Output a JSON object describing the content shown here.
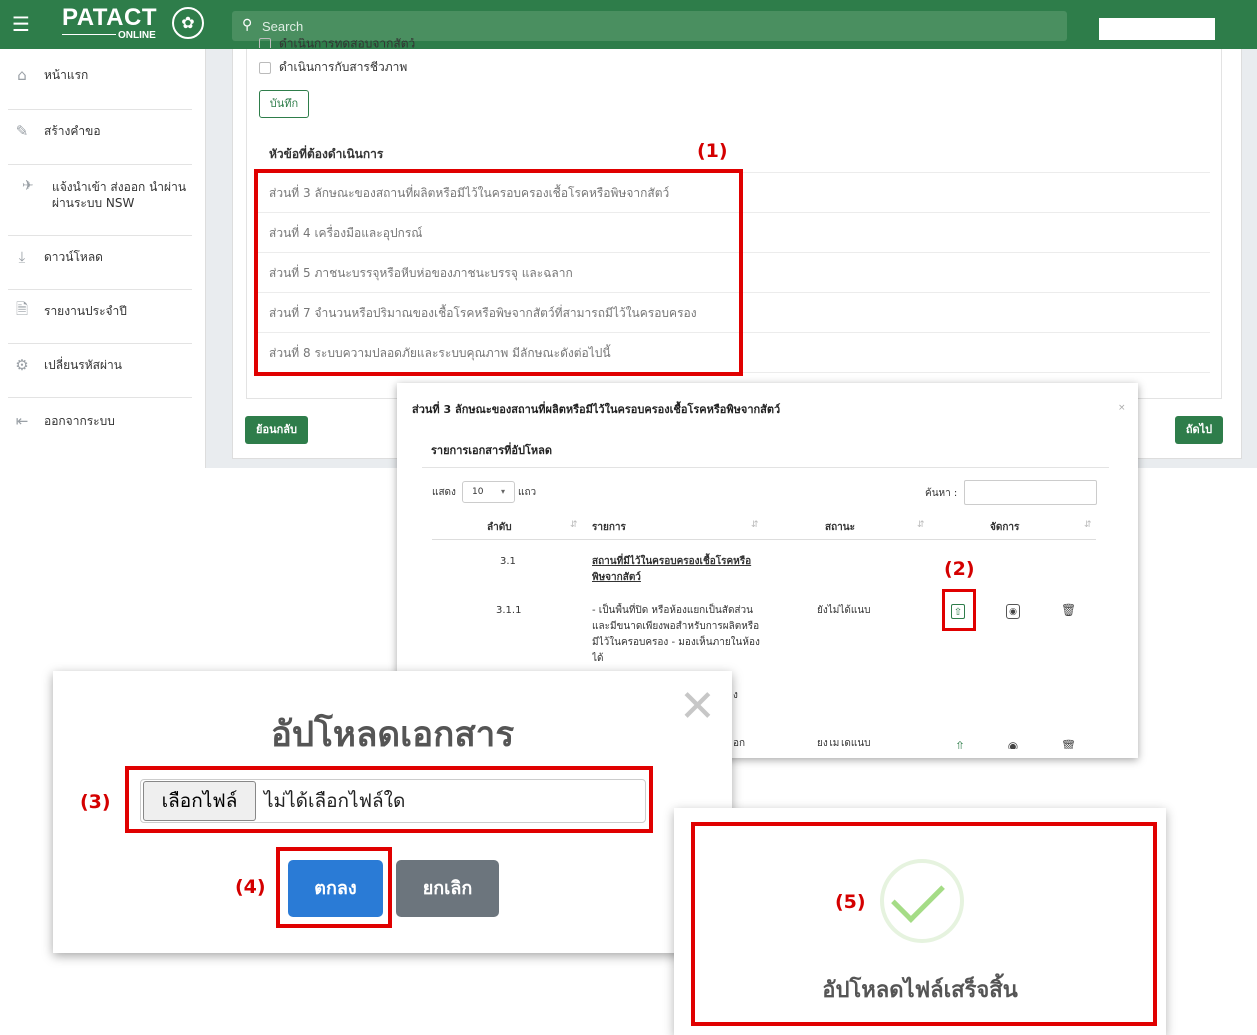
{
  "topbar": {
    "menu_icon": "hamburger-icon",
    "logo_text": "PATACT",
    "logo_sub": "ONLINE",
    "search_placeholder": "Search",
    "brand_color": "#2e7d4a"
  },
  "sidebar": {
    "items": [
      {
        "icon": "home-icon",
        "label": "หน้าแรก"
      },
      {
        "icon": "pencil-icon",
        "label": "สร้างคำขอ"
      },
      {
        "icon": "airplane-icon",
        "label": "แจ้งนำเข้า ส่งออก นำผ่าน ผ่านระบบ NSW"
      },
      {
        "icon": "download-icon",
        "label": "ดาวน์โหลด"
      },
      {
        "icon": "file-icon",
        "label": "รายงานประจำปี"
      },
      {
        "icon": "gears-icon",
        "label": "เปลี่ยนรหัสผ่าน"
      },
      {
        "icon": "logout-icon",
        "label": "ออกจากระบบ"
      }
    ]
  },
  "form": {
    "checkbox_partial": "ดำเนินการทดสอบจากสัตว์",
    "checkbox_label": "ดำเนินการกับสารชีวภาพ",
    "save_label": "บันทึก",
    "topics_heading": "หัวข้อที่ต้องดำเนินการ",
    "topics": [
      "ส่วนที่ 3 ลักษณะของสถานที่ผลิตหรือมีไว้ในครอบครองเชื้อโรคหรือพิษจากสัตว์",
      "ส่วนที่ 4 เครื่องมือและอุปกรณ์",
      "ส่วนที่ 5 ภาชนะบรรจุหรือหีบห่อของภาชนะบรรจุ และฉลาก",
      "ส่วนที่ 7 จำนวนหรือปริมาณของเชื้อโรคหรือพิษจากสัตว์ที่สามารถมีไว้ในครอบครอง",
      "ส่วนที่ 8 ระบบความปลอดภัยและระบบคุณภาพ มีลักษณะดังต่อไปนี้"
    ],
    "back_label": "ย้อนกลับ",
    "next_label": "ถัดไป"
  },
  "annotations": {
    "a1": "(1)",
    "a2": "(2)",
    "a3": "(3)",
    "a4": "(4)",
    "a5": "(5)"
  },
  "section_modal": {
    "title": "ส่วนที่ 3 ลักษณะของสถานที่ผลิตหรือมีไว้ในครอบครองเชื้อโรคหรือพิษจากสัตว์",
    "close": "×",
    "subtitle": "รายการเอกสารที่อัปโหลด",
    "show_label": "แสดง",
    "page_size": "10",
    "rows_label": "แถว",
    "search_label": "ค้นหา :",
    "columns": [
      "ลำดับ",
      "รายการ",
      "สถานะ",
      "จัดการ"
    ],
    "rows": [
      {
        "no": "3.1",
        "item": "สถานที่มีไว้ในครอบครองเชื้อโรคหรือพิษจากสัตว์",
        "status": ""
      },
      {
        "no": "3.1.1",
        "item": "- เป็นพื้นที่ปิด หรือห้องแยกเป็นสัดส่วน และมีขนาดเพียงพอสำหรับการผลิตหรือมีไว้ในครอบครอง - มองเห็นภายในห้องได้",
        "status": "ยังไม่ได้แนบ"
      },
      {
        "no": "",
        "item": "",
        "status": "ยังไม่ได้แนบ"
      }
    ],
    "partial_text_1": "ง",
    "partial_text_2": "อก"
  },
  "upload_dialog": {
    "title": "อัปโหลดเอกสาร",
    "choose_file": "เลือกไฟล์",
    "no_file": "ไม่ได้เลือกไฟล์ใด",
    "ok_label": "ตกลง",
    "cancel_label": "ยกเลิก"
  },
  "success_dialog": {
    "message": "อัปโหลดไฟล์เสร็จสิ้น"
  }
}
